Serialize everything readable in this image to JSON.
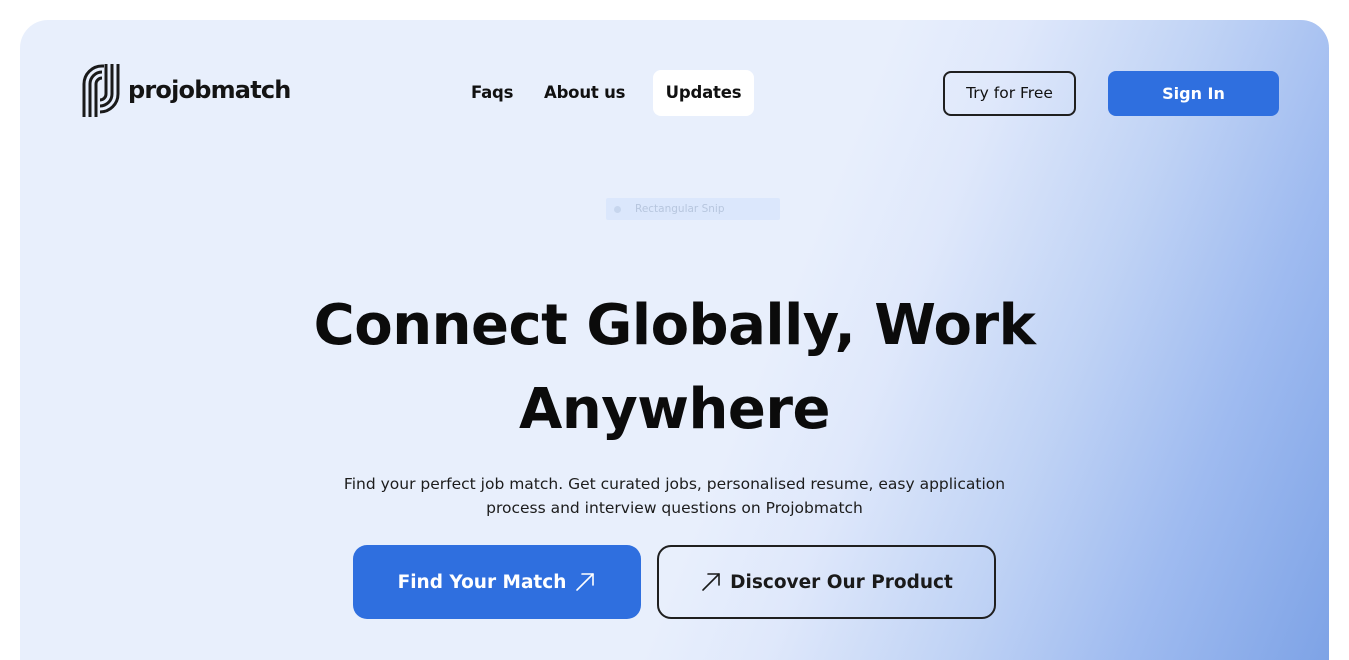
{
  "logo": {
    "text": "projobmatch",
    "icon": "projobmatch-logo-icon"
  },
  "nav": {
    "items": [
      {
        "label": "Faqs"
      },
      {
        "label": "About us"
      },
      {
        "label": "Updates",
        "active": true
      }
    ]
  },
  "header_actions": {
    "try_label": "Try for Free",
    "signin_label": "Sign In"
  },
  "snip_overlay": {
    "label": "Rectangular Snip"
  },
  "hero": {
    "headline_line1": "Connect Globally, Work",
    "headline_line2": "Anywhere",
    "subtext": "Find your perfect job match. Get curated jobs, personalised resume, easy application process and interview questions on Projobmatch",
    "primary_cta": "Find Your Match",
    "secondary_cta": "Discover Our Product",
    "cta_icon": "arrow-up-right-icon"
  },
  "colors": {
    "accent": "#2f6fdf",
    "background": "#e8effc",
    "gradient_end": "#7ea3e6",
    "text": "#0b0b0b"
  }
}
